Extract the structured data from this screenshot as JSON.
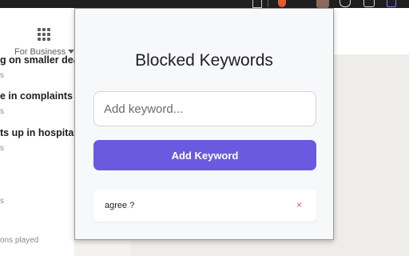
{
  "background_page": {
    "for_business_label": "For Business",
    "news": [
      {
        "title": "g on smaller dea",
        "meta": "s"
      },
      {
        "title": "e in complaints",
        "meta": "s"
      },
      {
        "title": "ts up in hospital",
        "meta": "s"
      },
      {
        "title": "",
        "meta": "s"
      }
    ],
    "footer_text": "ons played"
  },
  "popup": {
    "title": "Blocked Keywords",
    "input": {
      "placeholder": "Add keyword...",
      "value": ""
    },
    "add_button_label": "Add Keyword",
    "keywords": [
      {
        "text": "agree ?",
        "remove_label": "×"
      }
    ]
  },
  "colors": {
    "accent": "#6a5ae0",
    "remove": "#e05757",
    "popup_bg": "#f7f8fa"
  }
}
